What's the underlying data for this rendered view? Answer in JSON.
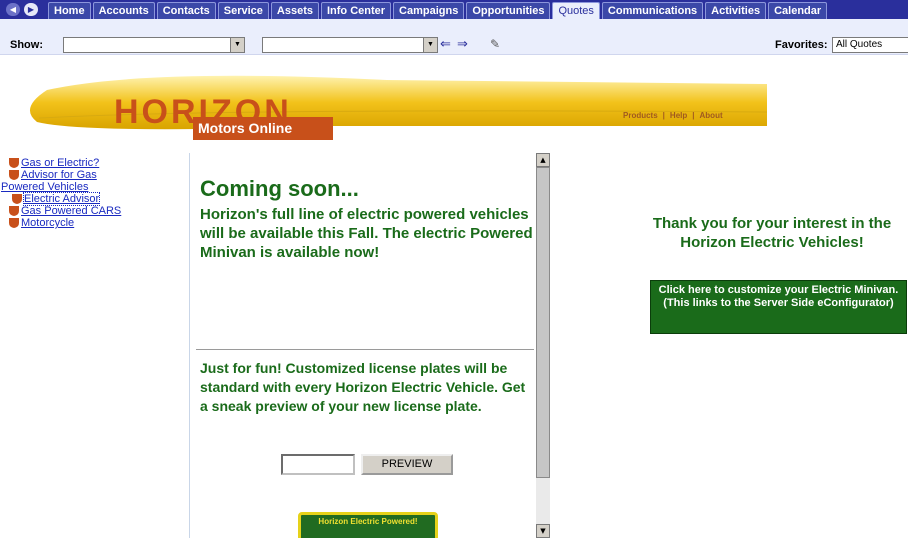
{
  "tabbar": {
    "tabs": [
      {
        "label": "Home"
      },
      {
        "label": "Accounts"
      },
      {
        "label": "Contacts"
      },
      {
        "label": "Service"
      },
      {
        "label": "Assets"
      },
      {
        "label": "Info Center"
      },
      {
        "label": "Campaigns"
      },
      {
        "label": "Opportunities"
      },
      {
        "label": "Quotes",
        "active": true
      },
      {
        "label": "Communications"
      },
      {
        "label": "Activities"
      },
      {
        "label": "Calendar"
      }
    ]
  },
  "toolbar": {
    "show_label": "Show:",
    "show_value": "",
    "view_value": "",
    "favorites_label": "Favorites:",
    "favorites_value": "All Quotes"
  },
  "banner": {
    "logo": "HORIZON",
    "logo_sub": "Motors Online",
    "links": [
      "Products",
      "Help",
      "About"
    ]
  },
  "leftnav": {
    "items": [
      {
        "label": "Gas or Electric?"
      },
      {
        "label": "Advisor for Gas"
      },
      {
        "label": "Powered Vehicles"
      },
      {
        "label": "Electric Advisor"
      },
      {
        "label": "Gas Powered CARS"
      },
      {
        "label": "Motorcycle"
      }
    ]
  },
  "center": {
    "heading": "Coming soon...",
    "body": "Horizon's full line of electric powered vehicles will be available this Fall. The electric Powered Minivan is available now!",
    "fun_text": "Just for fun! Customized license plates will be standard with every Horizon Electric Vehicle. Get a sneak preview of your new license plate.",
    "plate_input_value": "",
    "preview_button": "PREVIEW",
    "plate_text": "Horizon Electric Powered!"
  },
  "right": {
    "thanks": "Thank you for your interest in the Horizon Electric Vehicles!",
    "customize_button": "Click here to customize your Electric Minivan. (This links to the Server Side eConfigurator)"
  },
  "colors": {
    "tabbar_bg": "#2a2f9c",
    "toolbar_bg": "#eaeefc",
    "brand_orange": "#c8501a",
    "banner_yellow": "#f2c21a",
    "text_green": "#1a6b1a",
    "link_blue": "#1a2ac0"
  }
}
